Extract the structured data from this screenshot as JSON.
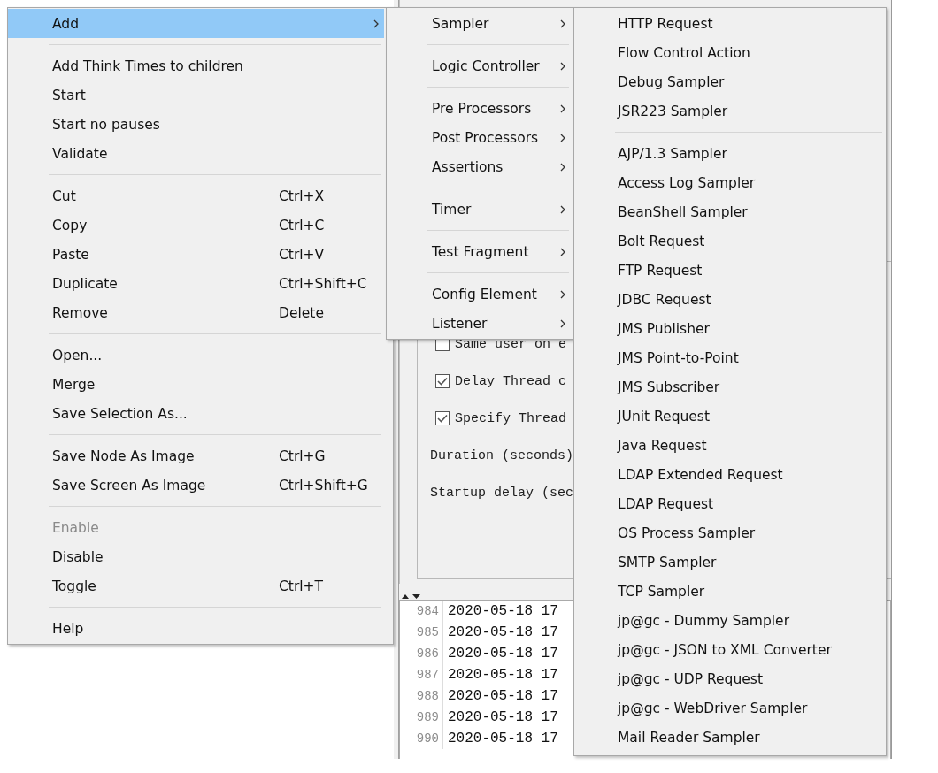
{
  "context_menu": {
    "items": [
      {
        "kind": "item",
        "label": "Add",
        "has_submenu": true,
        "selected": true,
        "disabled": false
      },
      {
        "kind": "separator"
      },
      {
        "kind": "item",
        "label": "Add Think Times to children",
        "selected": false,
        "disabled": false
      },
      {
        "kind": "item",
        "label": "Start",
        "selected": false,
        "disabled": false
      },
      {
        "kind": "item",
        "label": "Start no pauses",
        "selected": false,
        "disabled": false
      },
      {
        "kind": "item",
        "label": "Validate",
        "selected": false,
        "disabled": false
      },
      {
        "kind": "separator"
      },
      {
        "kind": "item",
        "label": "Cut",
        "shortcut": "Ctrl+X",
        "selected": false,
        "disabled": false
      },
      {
        "kind": "item",
        "label": "Copy",
        "shortcut": "Ctrl+C",
        "selected": false,
        "disabled": false
      },
      {
        "kind": "item",
        "label": "Paste",
        "shortcut": "Ctrl+V",
        "selected": false,
        "disabled": false
      },
      {
        "kind": "item",
        "label": "Duplicate",
        "shortcut": "Ctrl+Shift+C",
        "selected": false,
        "disabled": false
      },
      {
        "kind": "item",
        "label": "Remove",
        "shortcut": "Delete",
        "selected": false,
        "disabled": false
      },
      {
        "kind": "separator"
      },
      {
        "kind": "item",
        "label": "Open...",
        "selected": false,
        "disabled": false
      },
      {
        "kind": "item",
        "label": "Merge",
        "selected": false,
        "disabled": false
      },
      {
        "kind": "item",
        "label": "Save Selection As...",
        "selected": false,
        "disabled": false
      },
      {
        "kind": "separator"
      },
      {
        "kind": "item",
        "label": "Save Node As Image",
        "shortcut": "Ctrl+G",
        "selected": false,
        "disabled": false
      },
      {
        "kind": "item",
        "label": "Save Screen As Image",
        "shortcut": "Ctrl+Shift+G",
        "selected": false,
        "disabled": false
      },
      {
        "kind": "separator"
      },
      {
        "kind": "item",
        "label": "Enable",
        "selected": false,
        "disabled": true
      },
      {
        "kind": "item",
        "label": "Disable",
        "selected": false,
        "disabled": false
      },
      {
        "kind": "item",
        "label": "Toggle",
        "shortcut": "Ctrl+T",
        "selected": false,
        "disabled": false
      },
      {
        "kind": "separator"
      },
      {
        "kind": "item",
        "label": "Help",
        "selected": false,
        "disabled": false
      }
    ]
  },
  "add_submenu": {
    "items": [
      {
        "kind": "item",
        "label": "Sampler",
        "has_submenu": true,
        "selected": false,
        "disabled": false
      },
      {
        "kind": "separator"
      },
      {
        "kind": "item",
        "label": "Logic Controller",
        "has_submenu": true,
        "selected": false,
        "disabled": false
      },
      {
        "kind": "separator"
      },
      {
        "kind": "item",
        "label": "Pre Processors",
        "has_submenu": true,
        "selected": false,
        "disabled": false
      },
      {
        "kind": "item",
        "label": "Post Processors",
        "has_submenu": true,
        "selected": false,
        "disabled": false
      },
      {
        "kind": "item",
        "label": "Assertions",
        "has_submenu": true,
        "selected": false,
        "disabled": false
      },
      {
        "kind": "separator"
      },
      {
        "kind": "item",
        "label": "Timer",
        "has_submenu": true,
        "selected": false,
        "disabled": false
      },
      {
        "kind": "separator"
      },
      {
        "kind": "item",
        "label": "Test Fragment",
        "has_submenu": true,
        "selected": false,
        "disabled": false
      },
      {
        "kind": "separator"
      },
      {
        "kind": "item",
        "label": "Config Element",
        "has_submenu": true,
        "selected": false,
        "disabled": false
      },
      {
        "kind": "item",
        "label": "Listener",
        "has_submenu": true,
        "selected": false,
        "disabled": false
      }
    ]
  },
  "sampler_submenu": {
    "items": [
      {
        "kind": "item",
        "label": "HTTP Request",
        "selected": false,
        "disabled": false
      },
      {
        "kind": "item",
        "label": "Flow Control Action",
        "selected": false,
        "disabled": false
      },
      {
        "kind": "item",
        "label": "Debug Sampler",
        "selected": false,
        "disabled": false
      },
      {
        "kind": "item",
        "label": "JSR223 Sampler",
        "selected": false,
        "disabled": false
      },
      {
        "kind": "separator"
      },
      {
        "kind": "item",
        "label": "AJP/1.3 Sampler",
        "selected": false,
        "disabled": false
      },
      {
        "kind": "item",
        "label": "Access Log Sampler",
        "selected": false,
        "disabled": false
      },
      {
        "kind": "item",
        "label": "BeanShell Sampler",
        "selected": false,
        "disabled": false
      },
      {
        "kind": "item",
        "label": "Bolt Request",
        "selected": false,
        "disabled": false
      },
      {
        "kind": "item",
        "label": "FTP Request",
        "selected": false,
        "disabled": false
      },
      {
        "kind": "item",
        "label": "JDBC Request",
        "selected": false,
        "disabled": false
      },
      {
        "kind": "item",
        "label": "JMS Publisher",
        "selected": false,
        "disabled": false
      },
      {
        "kind": "item",
        "label": "JMS Point-to-Point",
        "selected": false,
        "disabled": false
      },
      {
        "kind": "item",
        "label": "JMS Subscriber",
        "selected": false,
        "disabled": false
      },
      {
        "kind": "item",
        "label": "JUnit Request",
        "selected": false,
        "disabled": false
      },
      {
        "kind": "item",
        "label": "Java Request",
        "selected": false,
        "disabled": false
      },
      {
        "kind": "item",
        "label": "LDAP Extended Request",
        "selected": false,
        "disabled": false
      },
      {
        "kind": "item",
        "label": "LDAP Request",
        "selected": false,
        "disabled": false
      },
      {
        "kind": "item",
        "label": "OS Process Sampler",
        "selected": false,
        "disabled": false
      },
      {
        "kind": "item",
        "label": "SMTP Sampler",
        "selected": false,
        "disabled": false
      },
      {
        "kind": "item",
        "label": "TCP Sampler",
        "selected": false,
        "disabled": false
      },
      {
        "kind": "item",
        "label": "jp@gc - Dummy Sampler",
        "selected": false,
        "disabled": false
      },
      {
        "kind": "item",
        "label": "jp@gc - JSON to XML Converter",
        "selected": false,
        "disabled": false
      },
      {
        "kind": "item",
        "label": "jp@gc - UDP Request",
        "selected": false,
        "disabled": false
      },
      {
        "kind": "item",
        "label": "jp@gc - WebDriver Sampler",
        "selected": false,
        "disabled": false
      },
      {
        "kind": "item",
        "label": "Mail Reader Sampler",
        "selected": false,
        "disabled": false
      }
    ]
  },
  "thread_group_panel": {
    "options": [
      {
        "kind": "checkbox",
        "label": "Same user on e",
        "checked": false
      },
      {
        "kind": "checkbox",
        "label": "Delay Thread c",
        "checked": true
      },
      {
        "kind": "checkbox",
        "label": "Specify Thread",
        "checked": true
      },
      {
        "kind": "field",
        "label": "Duration (seconds)"
      },
      {
        "kind": "field",
        "label": "Startup delay (sec"
      }
    ]
  },
  "log": {
    "lines": [
      {
        "number": "984",
        "text": "2020-05-18 17"
      },
      {
        "number": "985",
        "text": "2020-05-18 17"
      },
      {
        "number": "986",
        "text": "2020-05-18 17"
      },
      {
        "number": "987",
        "text": "2020-05-18 17"
      },
      {
        "number": "988",
        "text": "2020-05-18 17"
      },
      {
        "number": "989",
        "text": "2020-05-18 17"
      },
      {
        "number": "990",
        "text": "2020-05-18 17"
      }
    ]
  }
}
